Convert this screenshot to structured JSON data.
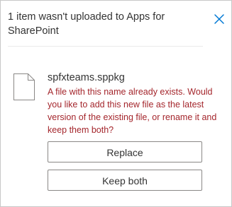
{
  "dialog": {
    "title": "1 item wasn't uploaded to Apps for SharePoint",
    "close_icon": "close-icon",
    "accent_color": "#0078d4",
    "error_color": "#a4262c"
  },
  "file": {
    "icon": "file-icon",
    "name": "spfxteams.sppkg",
    "message": "A file with this name already exists. Would you like to add this new file as the latest version of the existing file, or rename it and keep them both?"
  },
  "actions": {
    "replace_label": "Replace",
    "keep_both_label": "Keep both"
  }
}
